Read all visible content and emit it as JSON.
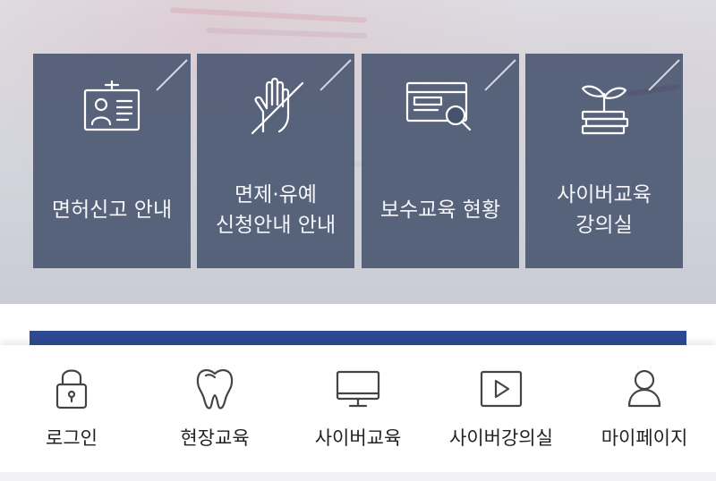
{
  "tiles": [
    {
      "line1": "면허신고 안내",
      "line2": "",
      "icon": "id-card-icon"
    },
    {
      "line1": "면제·유예",
      "line2": "신청안내 안내",
      "icon": "hand-icon"
    },
    {
      "line1": "보수교육 현황",
      "line2": "",
      "icon": "document-search-icon"
    },
    {
      "line1": "사이버교육",
      "line2": "강의실",
      "icon": "sprout-books-icon"
    }
  ],
  "tabbar": {
    "items": [
      {
        "label": "로그인",
        "icon": "lock-icon"
      },
      {
        "label": "현장교육",
        "icon": "tooth-icon"
      },
      {
        "label": "사이버교육",
        "icon": "monitor-icon"
      },
      {
        "label": "사이버강의실",
        "icon": "play-icon"
      },
      {
        "label": "마이페이지",
        "icon": "user-icon"
      }
    ]
  },
  "colors": {
    "tile_bg": "#46536d",
    "band": "#2e4a92",
    "tab_icon": "#444444"
  }
}
